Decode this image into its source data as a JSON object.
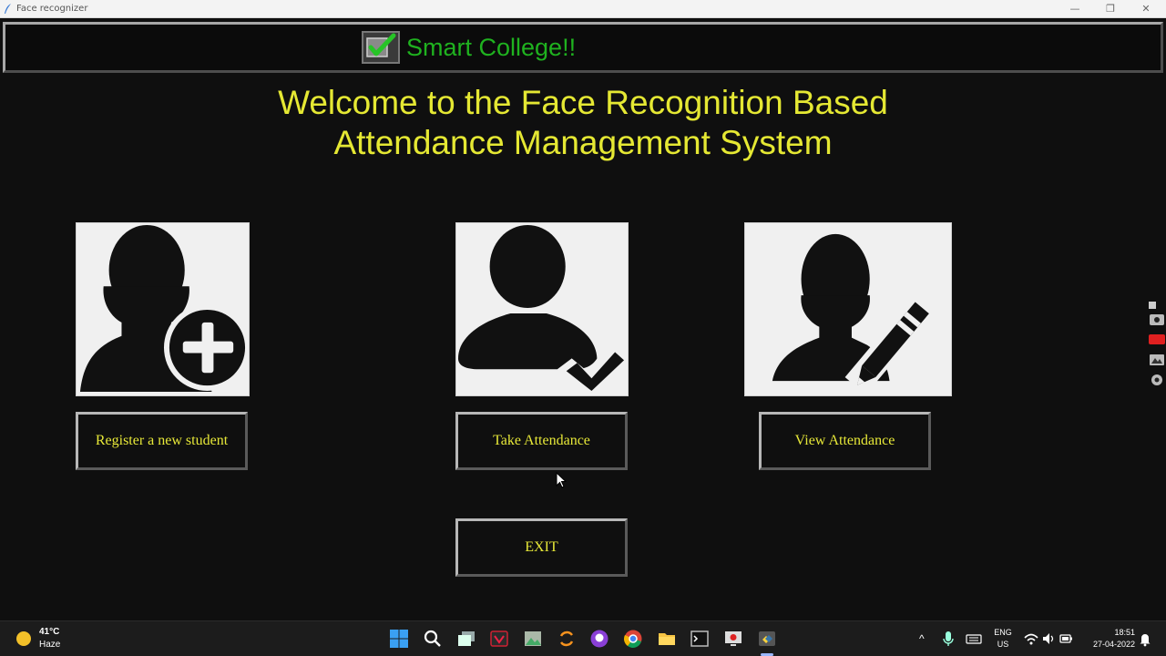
{
  "window": {
    "title": "Face recognizer",
    "minimize_glyph": "—",
    "restore_glyph": "❐",
    "close_glyph": "✕"
  },
  "header": {
    "brand": "Smart College!!",
    "logo_icon": "checkbox-check-icon"
  },
  "welcome": {
    "line1": "Welcome to the Face Recognition Based",
    "line2": "Attendance Management System"
  },
  "actions": {
    "register_label": "Register a new student",
    "take_label": "Take Attendance",
    "view_label": "View Attendance",
    "exit_label": "EXIT"
  },
  "icons": {
    "register": "user-add-icon",
    "take": "user-check-icon",
    "view": "user-edit-icon"
  },
  "taskbar": {
    "weather_temp": "41°C",
    "weather_desc": "Haze",
    "lang_top": "ENG",
    "lang_bottom": "US",
    "time": "18:51",
    "date": "27-04-2022"
  },
  "colors": {
    "accent_yellow": "#e5e833",
    "brand_green": "#1fb21f",
    "background": "#0f0f0f"
  }
}
